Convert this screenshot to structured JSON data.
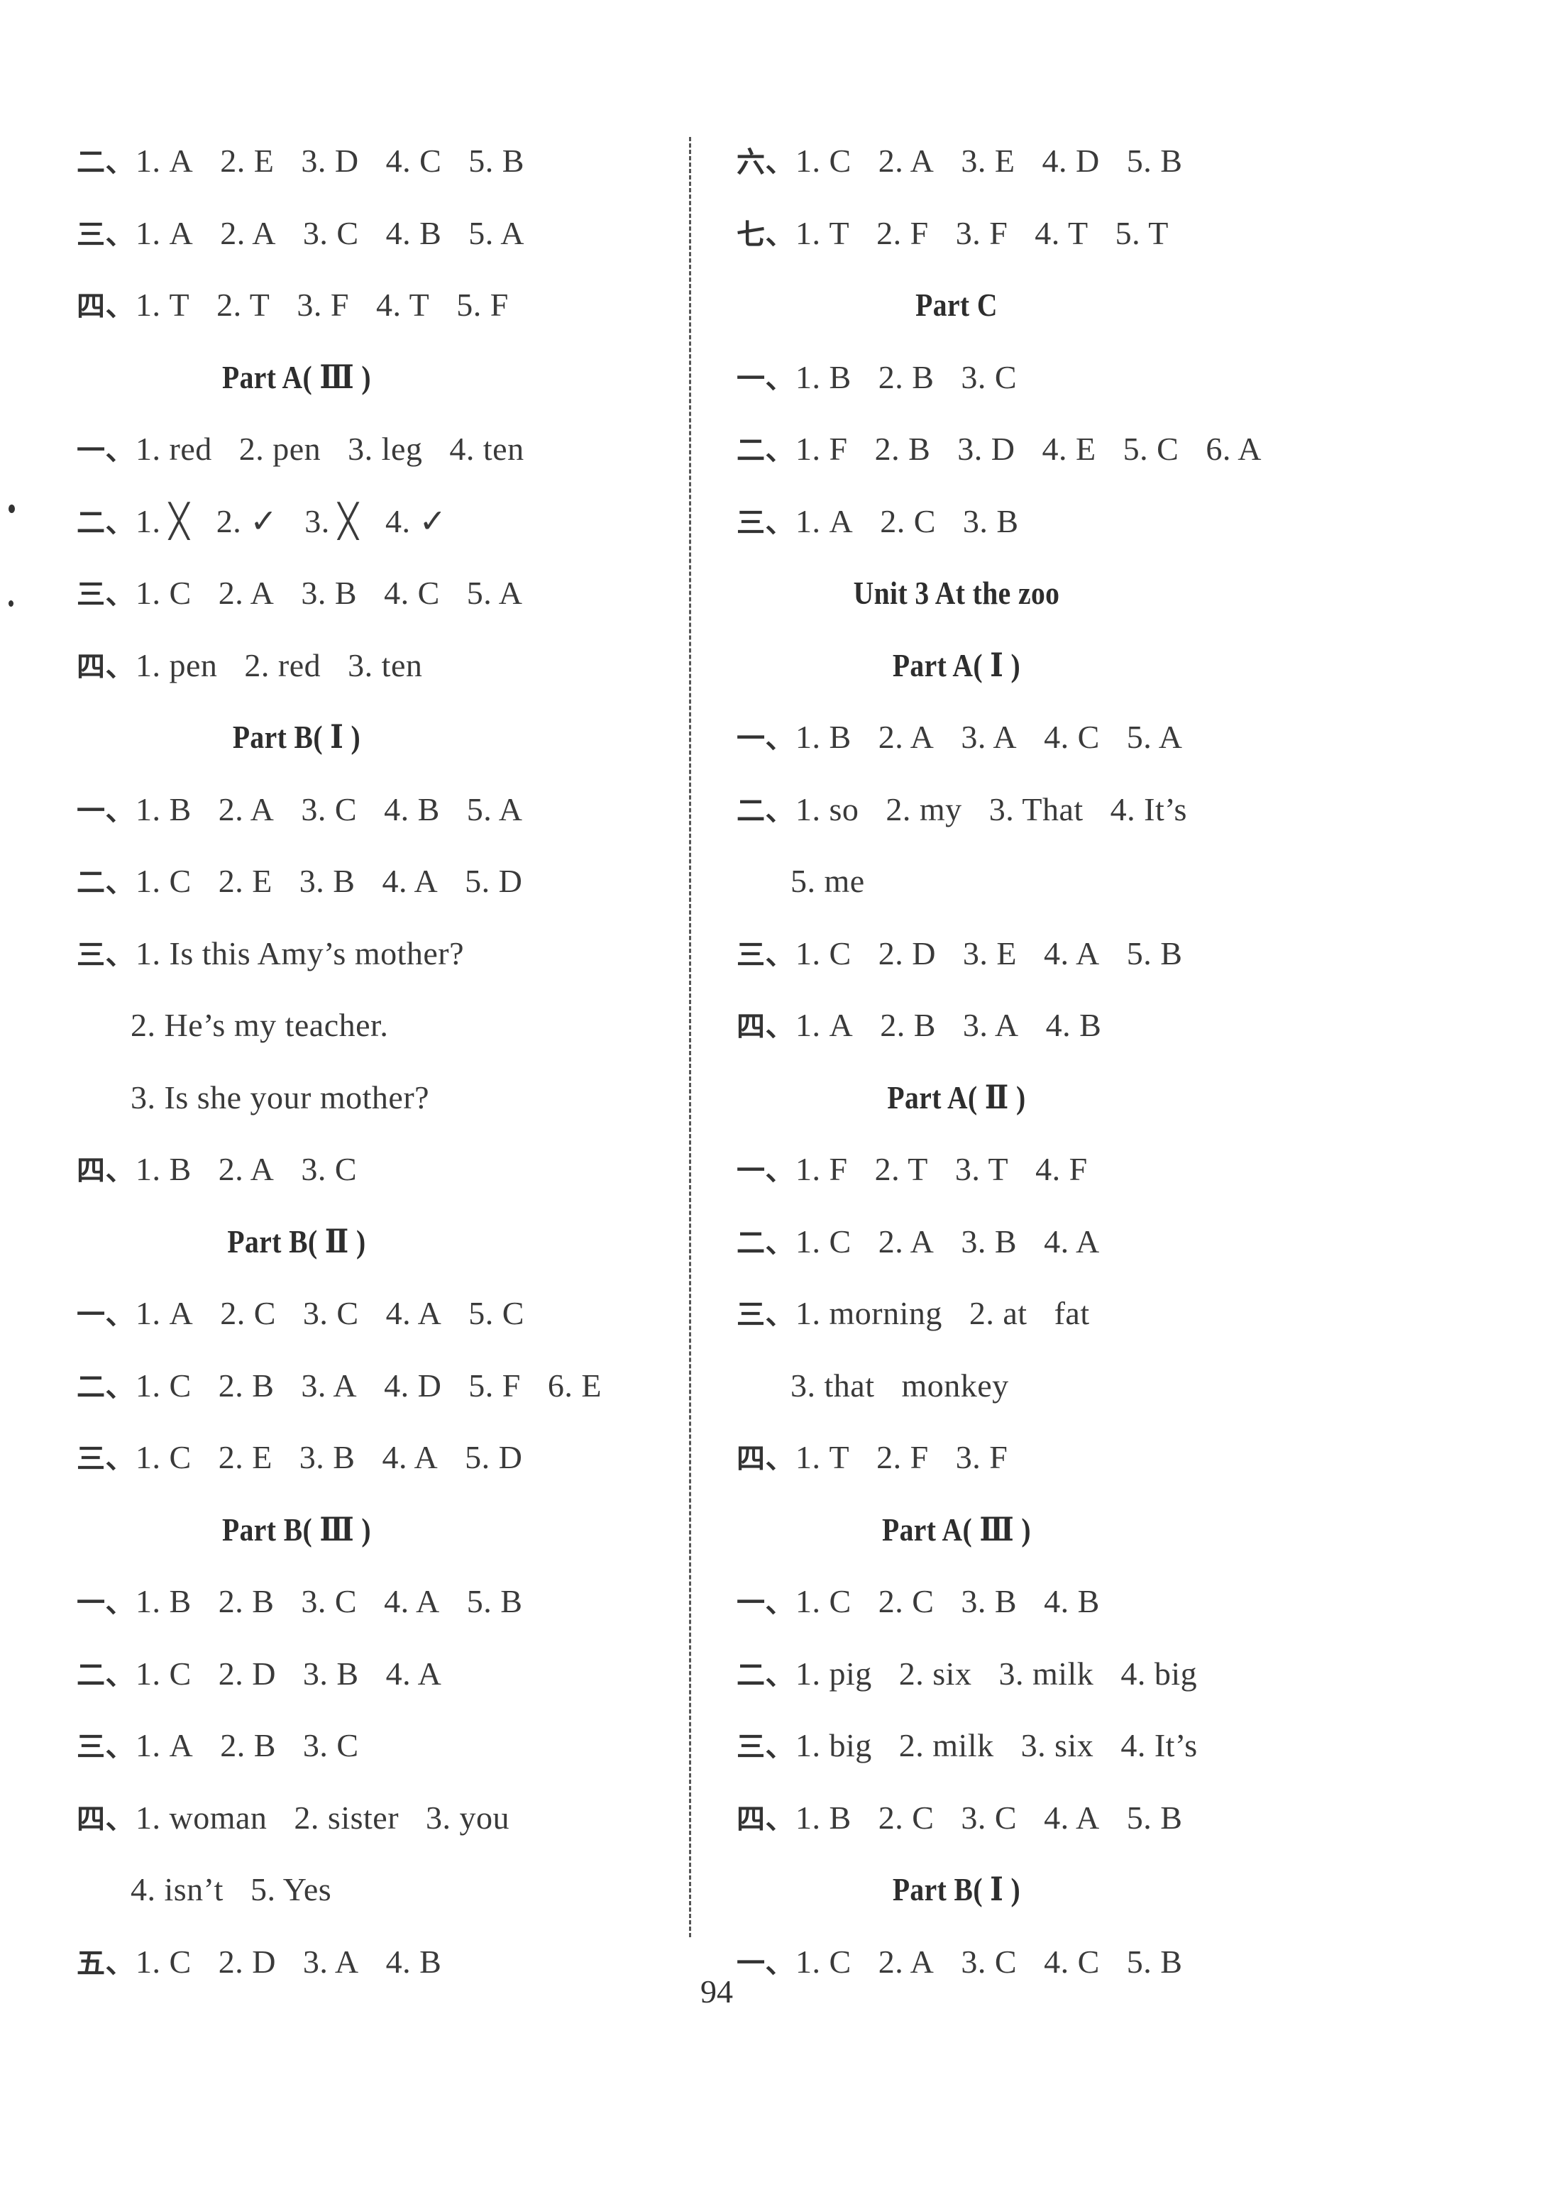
{
  "page_number": "94",
  "left_column": [
    {
      "type": "answers",
      "num": "二、",
      "items": [
        "1. A",
        "2. E",
        "3. D",
        "4. C",
        "5. B"
      ]
    },
    {
      "type": "answers",
      "num": "三、",
      "items": [
        "1. A",
        "2. A",
        "3. C",
        "4. B",
        "5. A"
      ]
    },
    {
      "type": "answers",
      "num": "四、",
      "items": [
        "1. T",
        "2. T",
        "3. F",
        "4. T",
        "5. F"
      ]
    },
    {
      "type": "heading",
      "text": "Part A( Ⅲ )"
    },
    {
      "type": "answers",
      "num": "一、",
      "items": [
        "1. red",
        "2. pen",
        "3. leg",
        "4. ten"
      ]
    },
    {
      "type": "answers",
      "num": "二、",
      "items": [
        "1. ╳",
        "2. ✓",
        "3. ╳",
        "4. ✓"
      ]
    },
    {
      "type": "answers",
      "num": "三、",
      "items": [
        "1. C",
        "2. A",
        "3. B",
        "4. C",
        "5. A"
      ]
    },
    {
      "type": "answers",
      "num": "四、",
      "items": [
        "1. pen",
        "2. red",
        "3. ten"
      ]
    },
    {
      "type": "heading",
      "text": "Part B( Ⅰ )"
    },
    {
      "type": "answers",
      "num": "一、",
      "items": [
        "1. B",
        "2. A",
        "3. C",
        "4. B",
        "5. A"
      ]
    },
    {
      "type": "answers",
      "num": "二、",
      "items": [
        "1. C",
        "2. E",
        "3. B",
        "4. A",
        "5. D"
      ]
    },
    {
      "type": "answers",
      "num": "三、",
      "items": [
        "1. Is this Amy’s mother?"
      ]
    },
    {
      "type": "continuation",
      "items": [
        "2. He’s my teacher."
      ]
    },
    {
      "type": "continuation",
      "items": [
        "3. Is she your mother?"
      ]
    },
    {
      "type": "answers",
      "num": "四、",
      "items": [
        "1. B",
        "2. A",
        "3. C"
      ]
    },
    {
      "type": "heading",
      "text": "Part B( Ⅱ )"
    },
    {
      "type": "answers",
      "num": "一、",
      "items": [
        "1. A",
        "2. C",
        "3. C",
        "4. A",
        "5. C"
      ]
    },
    {
      "type": "answers",
      "num": "二、",
      "items": [
        "1. C",
        "2. B",
        "3. A",
        "4. D",
        "5. F",
        "6. E"
      ]
    },
    {
      "type": "answers",
      "num": "三、",
      "items": [
        "1. C",
        "2. E",
        "3. B",
        "4. A",
        "5. D"
      ]
    },
    {
      "type": "heading",
      "text": "Part B( Ⅲ )"
    },
    {
      "type": "answers",
      "num": "一、",
      "items": [
        "1. B",
        "2. B",
        "3. C",
        "4. A",
        "5. B"
      ]
    },
    {
      "type": "answers",
      "num": "二、",
      "items": [
        "1. C",
        "2. D",
        "3. B",
        "4. A"
      ]
    },
    {
      "type": "answers",
      "num": "三、",
      "items": [
        "1. A",
        "2. B",
        "3. C"
      ]
    },
    {
      "type": "answers",
      "num": "四、",
      "items": [
        "1. woman",
        "2. sister",
        "3. you"
      ]
    },
    {
      "type": "continuation",
      "items": [
        "4. isn’t",
        "5. Yes"
      ]
    },
    {
      "type": "answers",
      "num": "五、",
      "items": [
        "1. C",
        "2. D",
        "3. A",
        "4. B"
      ]
    }
  ],
  "right_column": [
    {
      "type": "answers",
      "num": "六、",
      "items": [
        "1. C",
        "2. A",
        "3. E",
        "4. D",
        "5. B"
      ]
    },
    {
      "type": "answers",
      "num": "七、",
      "items": [
        "1. T",
        "2. F",
        "3. F",
        "4. T",
        "5. T"
      ]
    },
    {
      "type": "heading",
      "text": "Part C"
    },
    {
      "type": "answers",
      "num": "一、",
      "items": [
        "1. B",
        "2. B",
        "3. C"
      ]
    },
    {
      "type": "answers",
      "num": "二、",
      "items": [
        "1. F",
        "2. B",
        "3. D",
        "4. E",
        "5. C",
        "6. A"
      ]
    },
    {
      "type": "answers",
      "num": "三、",
      "items": [
        "1. A",
        "2. C",
        "3. B"
      ]
    },
    {
      "type": "heading",
      "text": "Unit 3    At the zoo"
    },
    {
      "type": "heading",
      "text": "Part A( Ⅰ )"
    },
    {
      "type": "answers",
      "num": "一、",
      "items": [
        "1. B",
        "2. A",
        "3. A",
        "4. C",
        "5. A"
      ]
    },
    {
      "type": "answers",
      "num": "二、",
      "items": [
        "1. so",
        "2. my",
        "3. That",
        "4. It’s"
      ]
    },
    {
      "type": "continuation",
      "items": [
        "5. me"
      ]
    },
    {
      "type": "answers",
      "num": "三、",
      "items": [
        "1. C",
        "2. D",
        "3. E",
        "4. A",
        "5. B"
      ]
    },
    {
      "type": "answers",
      "num": "四、",
      "items": [
        "1. A",
        "2. B",
        "3. A",
        "4. B"
      ]
    },
    {
      "type": "heading",
      "text": "Part A( Ⅱ )"
    },
    {
      "type": "answers",
      "num": "一、",
      "items": [
        "1. F",
        "2. T",
        "3. T",
        "4. F"
      ]
    },
    {
      "type": "answers",
      "num": "二、",
      "items": [
        "1. C",
        "2. A",
        "3. B",
        "4. A"
      ]
    },
    {
      "type": "answers",
      "num": "三、",
      "items": [
        "1. morning",
        "2. at",
        "fat"
      ]
    },
    {
      "type": "continuation",
      "items": [
        "3. that",
        "monkey"
      ]
    },
    {
      "type": "answers",
      "num": "四、",
      "items": [
        "1. T",
        "2. F",
        "3. F"
      ]
    },
    {
      "type": "heading",
      "text": "Part A( Ⅲ )"
    },
    {
      "type": "answers",
      "num": "一、",
      "items": [
        "1. C",
        "2. C",
        "3. B",
        "4. B"
      ]
    },
    {
      "type": "answers",
      "num": "二、",
      "items": [
        "1. pig",
        "2. six",
        "3. milk",
        "4. big"
      ]
    },
    {
      "type": "answers",
      "num": "三、",
      "items": [
        "1. big",
        "2. milk",
        "3. six",
        "4. It’s"
      ]
    },
    {
      "type": "answers",
      "num": "四、",
      "items": [
        "1. B",
        "2. C",
        "3. C",
        "4. A",
        "5. B"
      ]
    },
    {
      "type": "heading",
      "text": "Part B( Ⅰ )"
    },
    {
      "type": "answers",
      "num": "一、",
      "items": [
        "1. C",
        "2. A",
        "3. C",
        "4. C",
        "5. B"
      ]
    }
  ]
}
